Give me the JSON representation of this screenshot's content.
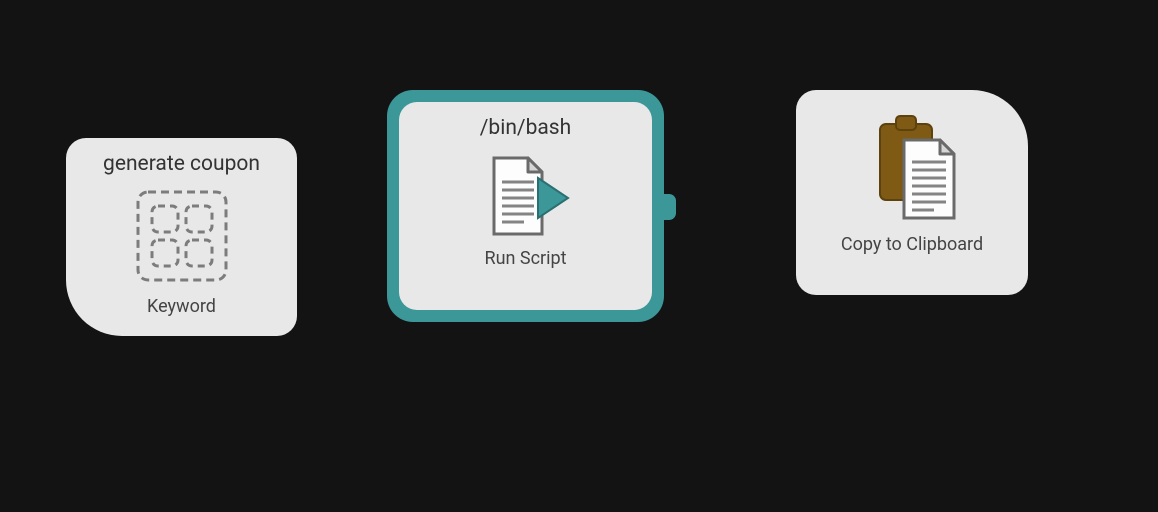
{
  "nodes": {
    "keyword": {
      "title": "generate coupon",
      "footer": "Keyword"
    },
    "runscript": {
      "title": "/bin/bash",
      "footer": "Run Script"
    },
    "clipboard": {
      "footer": "Copy to Clipboard"
    }
  }
}
